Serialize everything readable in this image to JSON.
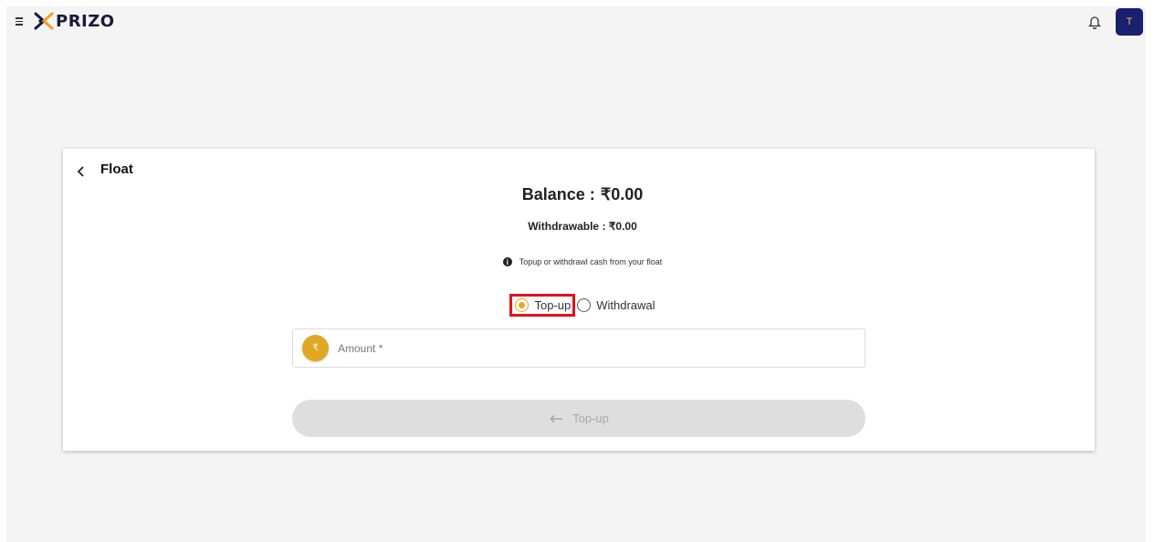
{
  "header": {
    "logo_text": "PRIZO",
    "avatar_initial": "T",
    "brand_color": "#1a1f6e",
    "accent_color": "#e5a91f"
  },
  "page": {
    "title": "Float",
    "balance_label": "Balance :",
    "balance_value": "₹0.00",
    "withdrawable_label": "Withdrawable :",
    "withdrawable_value": "₹0.00",
    "info_text": "Topup or withdrawl cash from your float",
    "info_icon": "info-icon"
  },
  "radio_options": [
    {
      "label": "Top-up",
      "selected": true
    },
    {
      "label": "Withdrawal",
      "selected": false
    }
  ],
  "amount_field": {
    "currency_symbol": "₹",
    "placeholder": "Amount *",
    "value": ""
  },
  "submit_button": {
    "label": "Top-up",
    "icon": "arrow-left-icon",
    "enabled": false
  }
}
